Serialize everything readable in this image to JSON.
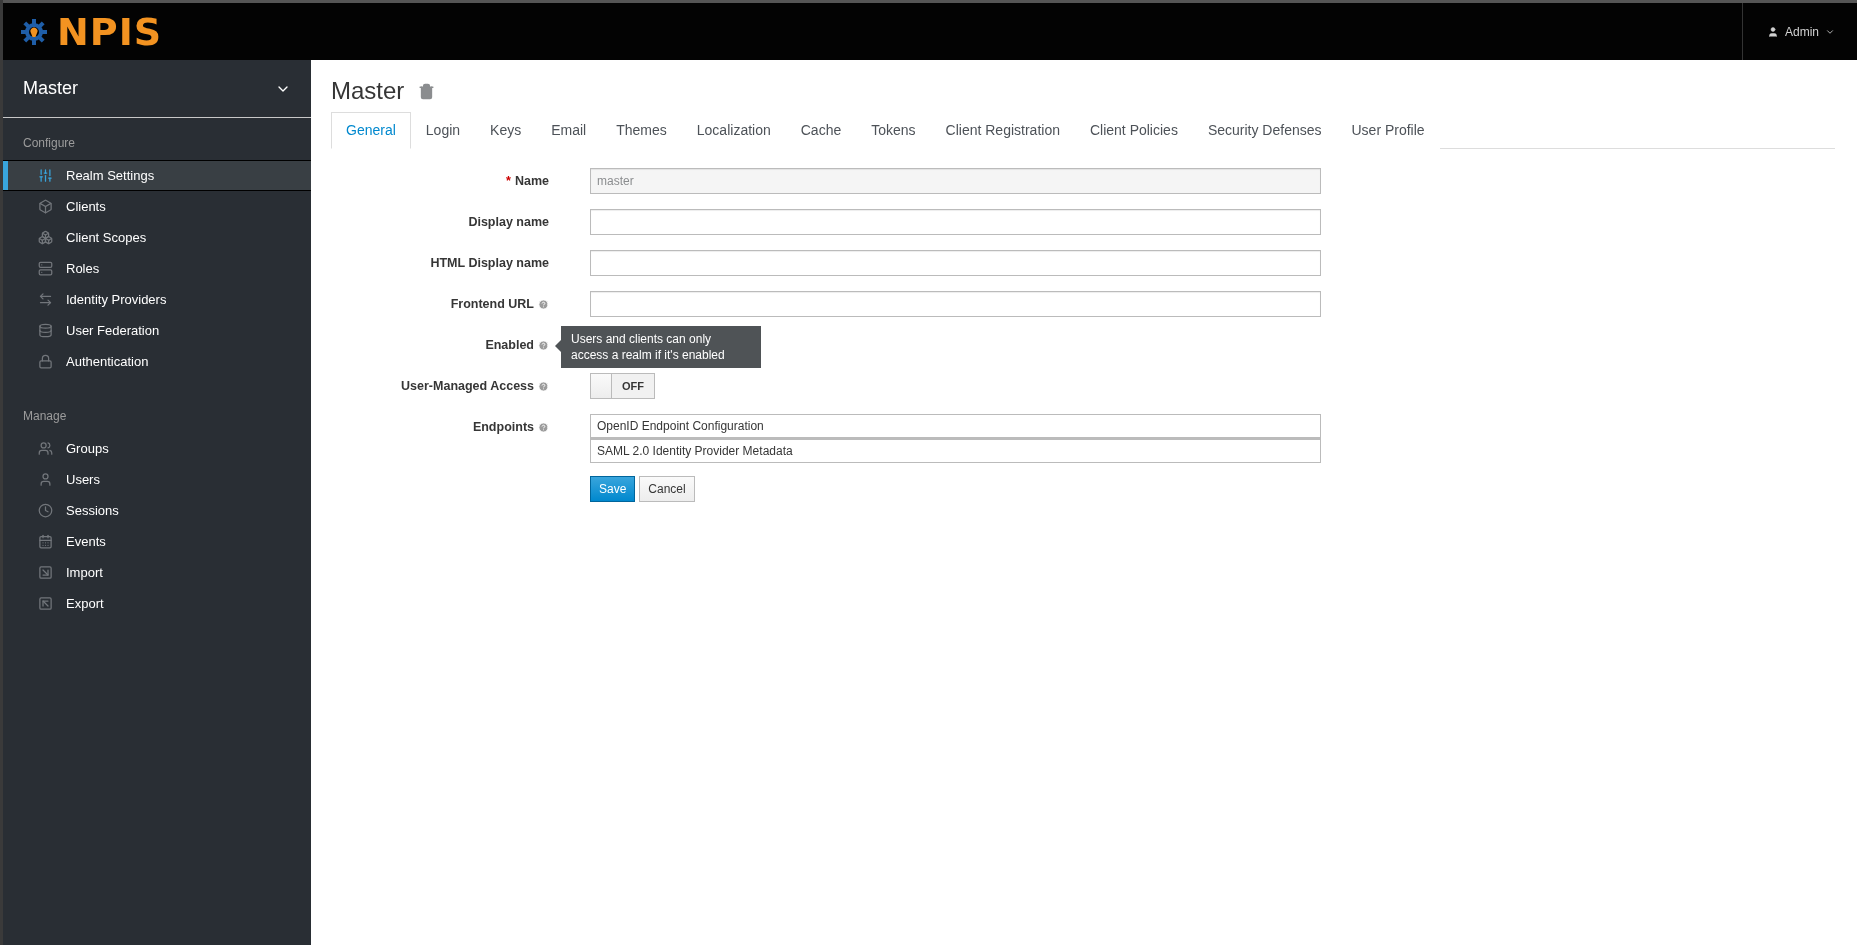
{
  "header": {
    "brand": "NPIS",
    "user": "Admin"
  },
  "sidebar": {
    "realm": "Master",
    "sections": [
      {
        "title": "Configure",
        "items": [
          {
            "label": "Realm Settings",
            "selected": true
          },
          {
            "label": "Clients",
            "selected": false
          },
          {
            "label": "Client Scopes",
            "selected": false
          },
          {
            "label": "Roles",
            "selected": false
          },
          {
            "label": "Identity Providers",
            "selected": false
          },
          {
            "label": "User Federation",
            "selected": false
          },
          {
            "label": "Authentication",
            "selected": false
          }
        ]
      },
      {
        "title": "Manage",
        "items": [
          {
            "label": "Groups",
            "selected": false
          },
          {
            "label": "Users",
            "selected": false
          },
          {
            "label": "Sessions",
            "selected": false
          },
          {
            "label": "Events",
            "selected": false
          },
          {
            "label": "Import",
            "selected": false
          },
          {
            "label": "Export",
            "selected": false
          }
        ]
      }
    ]
  },
  "page": {
    "title": "Master"
  },
  "tabs": [
    {
      "label": "General",
      "selected": true
    },
    {
      "label": "Login",
      "selected": false
    },
    {
      "label": "Keys",
      "selected": false
    },
    {
      "label": "Email",
      "selected": false
    },
    {
      "label": "Themes",
      "selected": false
    },
    {
      "label": "Localization",
      "selected": false
    },
    {
      "label": "Cache",
      "selected": false
    },
    {
      "label": "Tokens",
      "selected": false
    },
    {
      "label": "Client Registration",
      "selected": false
    },
    {
      "label": "Client Policies",
      "selected": false
    },
    {
      "label": "Security Defenses",
      "selected": false
    },
    {
      "label": "User Profile",
      "selected": false
    }
  ],
  "form": {
    "required_mark": "*",
    "fields": [
      {
        "kind": "text",
        "label": "Name",
        "required": true,
        "help": false,
        "value": "master",
        "disabled": true
      },
      {
        "kind": "text",
        "label": "Display name",
        "required": false,
        "help": false
      },
      {
        "kind": "text",
        "label": "HTML Display name",
        "required": false,
        "help": false
      },
      {
        "kind": "text",
        "label": "Frontend URL",
        "required": false,
        "help": true
      },
      {
        "kind": "covered",
        "label": "Enabled",
        "required": false,
        "help": true,
        "tooltip": "Users and clients can only access a realm if it's enabled"
      },
      {
        "kind": "switch",
        "label": "User-Managed Access",
        "required": false,
        "help": true,
        "on": false,
        "state_text": "OFF"
      },
      {
        "kind": "links",
        "label": "Endpoints",
        "required": false,
        "help": true,
        "links": [
          "OpenID Endpoint Configuration",
          "SAML 2.0 Identity Provider Metadata"
        ]
      }
    ],
    "buttons": [
      {
        "label": "Save",
        "kind": "primary"
      },
      {
        "label": "Cancel",
        "kind": "default"
      }
    ]
  }
}
